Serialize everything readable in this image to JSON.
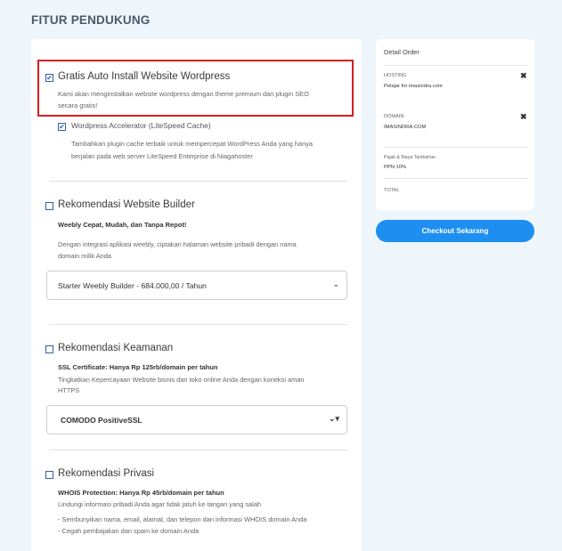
{
  "page": {
    "title": "FITUR PENDUKUNG"
  },
  "auto_install": {
    "title": "Gratis Auto Install Website Wordpress",
    "desc_line1": "Kami akan menginstalkan website wordpress dengan theme premium dan plugin SEO",
    "desc_line2": "secara gratis!",
    "checked": true,
    "accelerator": {
      "title": "Wordpress Accelerator (LiteSpeed Cache)",
      "desc_line1": "Tambahkan plugin cache terbaik untuk mempercepat WordPress Anda yang hanya",
      "desc_line2": "berjalan pada web server LiteSpeed Enterprise di Niagahoster",
      "checked": true
    }
  },
  "builder": {
    "title": "Rekomendasi Website Builder",
    "subtitle": "Weebly Cepat, Mudah, dan Tanpa Repot!",
    "desc_line1": "Dengan integrasi aplikasi weebly, ciptakan halaman website pribadi dengan nama",
    "desc_line2": "domain milik Anda",
    "select_value": "Starter Weebly Builder - 684.000,00 / Tahun"
  },
  "security": {
    "title": "Rekomendasi Keamanan",
    "subtitle": "SSL Certificate: Hanya Rp 125rb/domain per tahun",
    "desc_line1": "Tingkatkan Kepercayaan Website bisnis dan toko online Anda dengan koneksi aman",
    "desc_line2": "HTTPS",
    "select_value": "COMODO PositiveSSL"
  },
  "privacy": {
    "title": "Rekomendasi Privasi",
    "subtitle": "WHOIS Protection: Hanya Rp 45rb/domain per tahun",
    "desc_line1": "Lindungi informasi pribadi Anda agar tidak jatuh ke tangan yang salah",
    "bullet1": "- Sembunyikan nama, email, alamat, dan telepon dari informasi WHOIS domain Anda",
    "bullet2": "- Cegah pembajakan dan spam ke domain Anda"
  },
  "order": {
    "title": "Detail Order",
    "hosting_label": "HOSTING",
    "hosting_value": "Pelajar for imasindra.com",
    "domain_label": "DOMAIN",
    "domain_value": "IMASINDRA.COM",
    "tax_label": "Pajak & Biaya Tambahan",
    "tax_value": "PPN 10%",
    "total_label": "TOTAL",
    "remove_glyph": "✖",
    "checkout_label": "Checkout Sekarang"
  },
  "colors": {
    "accent": "#1e8ff0",
    "highlight": "#d81e1e",
    "checkbox": "#2f5fa8"
  },
  "icons": {
    "checked": "check-icon",
    "remove": "close-icon",
    "dropdown": "chevron-down-icon"
  }
}
